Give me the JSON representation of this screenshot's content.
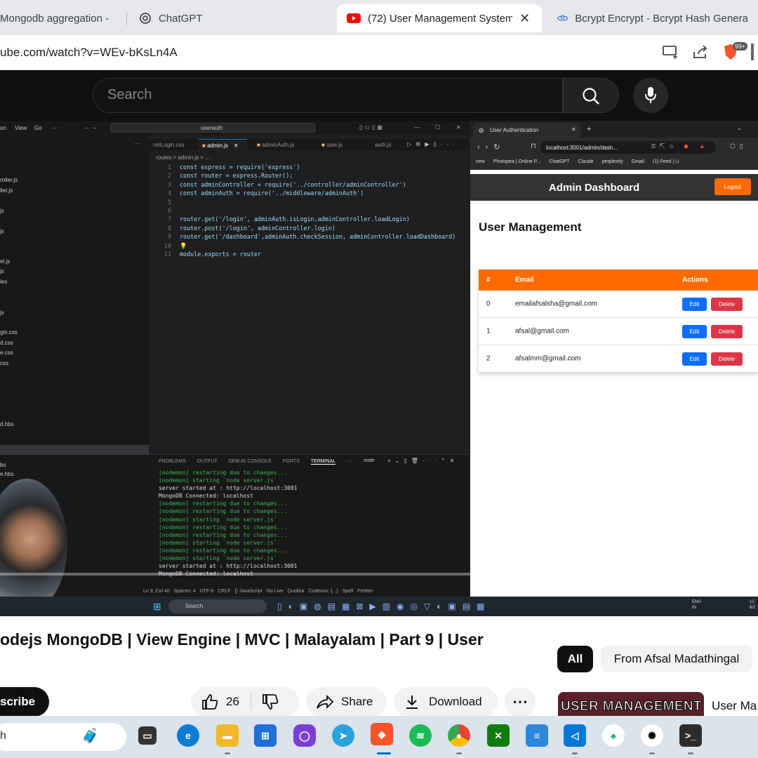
{
  "browser": {
    "tabs": [
      {
        "label": "Mongodb aggregation -"
      },
      {
        "label": "ChatGPT"
      },
      {
        "label": "(72) User Management System"
      },
      {
        "label": "Bcrypt Encrypt - Bcrypt Hash Genera"
      }
    ],
    "url": "ube.com/watch?v=WEv-bKsLn4A",
    "badge": "99+"
  },
  "youtube": {
    "search_placeholder": "Search",
    "video_title": "odejs MongoDB | View Engine | MVC | Malayalam | Part 9 | User",
    "subscribe_label": "scribe",
    "like_count": "26",
    "share_label": "Share",
    "download_label": "Download",
    "chip_all": "All",
    "chip_from": "From Afsal Madathingal",
    "thumb_text": "USER MANAGEMENT",
    "suggest_title": "User Ma"
  },
  "vscode": {
    "menu": [
      "on",
      "View",
      "Go",
      "···"
    ],
    "search": "userauth",
    "tabs": [
      "ninLogin.css",
      "admin.js",
      "adminAuth.js",
      "user.js",
      "auth.js"
    ],
    "breadcrumb": "routes > admin.js > ...",
    "side_files": [
      "roller.js",
      "ller.js",
      "js",
      "js",
      "el.js",
      "js",
      "ies",
      "js",
      "gin.css",
      "d.css",
      "e.css",
      "css",
      "d.hbs",
      "bs",
      "e.hbs"
    ],
    "code": [
      {
        "n": "1",
        "t": "const express = require('express')"
      },
      {
        "n": "2",
        "t": "const router = express.Router();"
      },
      {
        "n": "3",
        "t": "const adminController = require('../controller/adminController')"
      },
      {
        "n": "4",
        "t": "const adminAuth = require('../middleware/adminAuth')"
      },
      {
        "n": "5",
        "t": ""
      },
      {
        "n": "6",
        "t": ""
      },
      {
        "n": "7",
        "t": "router.get('/login', adminAuth.isLogin,adminController.loadLogin)"
      },
      {
        "n": "8",
        "t": "router.post('/login', adminController.login)"
      },
      {
        "n": "9",
        "t": "router.get('/dashboard',adminAuth.checkSession, adminController.loadDashboard)"
      },
      {
        "n": "10",
        "t": "💡"
      },
      {
        "n": "11",
        "t": "module.exports = router"
      }
    ],
    "panel_tabs": [
      "PROBLEMS",
      "OUTPUT",
      "DEBUG CONSOLE",
      "PORTS",
      "TERMINAL",
      "···"
    ],
    "terminal_shell": "node",
    "terminal": [
      {
        "t": "[nodemon] restarting due to changes...",
        "c": "g"
      },
      {
        "t": "[nodemon] starting `node server.js`",
        "c": "g"
      },
      {
        "t": "server started at : http://localhost:3001",
        "c": "w"
      },
      {
        "t": "MongoDB Connected: localhost",
        "c": "w"
      },
      {
        "t": "[nodemon] restarting due to changes...",
        "c": "g"
      },
      {
        "t": "[nodemon] restarting due to changes...",
        "c": "g"
      },
      {
        "t": "[nodemon] starting `node server.js`",
        "c": "g"
      },
      {
        "t": "[nodemon] restarting due to changes...",
        "c": "g"
      },
      {
        "t": "[nodemon] restarting due to changes...",
        "c": "g"
      },
      {
        "t": "[nodemon] starting `node server.js`",
        "c": "g"
      },
      {
        "t": "[nodemon] restarting due to changes...",
        "c": "g"
      },
      {
        "t": "[nodemon] starting `node server.js`",
        "c": "g"
      },
      {
        "t": "server started at : http://localhost:3001",
        "c": "w"
      },
      {
        "t": "MongoDB Connected: localhost",
        "c": "w"
      }
    ],
    "status": "Ln 9, Col 40   Spaces: 4   UTF-8   CRLF   {} JavaScript   Go Live   Quokka   Codeium: {...}   Spell   Prettier"
  },
  "inner_browser": {
    "tab_label": "User Authentication",
    "url": "localhost:3001/admin/dash...",
    "bookmarks": [
      "new",
      "Photopea | Online P...",
      "ChatGPT",
      "Claude",
      "perplexity",
      "Gmail",
      "(1) Feed | Li"
    ],
    "app_title": "Admin Dashboard",
    "logout_label": "Logout",
    "section_title": "User Management",
    "columns": [
      "#",
      "Email",
      "Actions"
    ],
    "rows": [
      {
        "id": "0",
        "email": "emailafsalsha@gmail.com"
      },
      {
        "id": "1",
        "email": "afsal@gmail.com"
      },
      {
        "id": "2",
        "email": "afsalmm@gmail.com"
      }
    ],
    "edit_label": "Edit",
    "delete_label": "Delete"
  },
  "video_taskbar": {
    "search": "Search",
    "lang": "ENG\nIN",
    "time": "12\n8/2"
  },
  "os_taskbar": {
    "search_text": "h"
  }
}
